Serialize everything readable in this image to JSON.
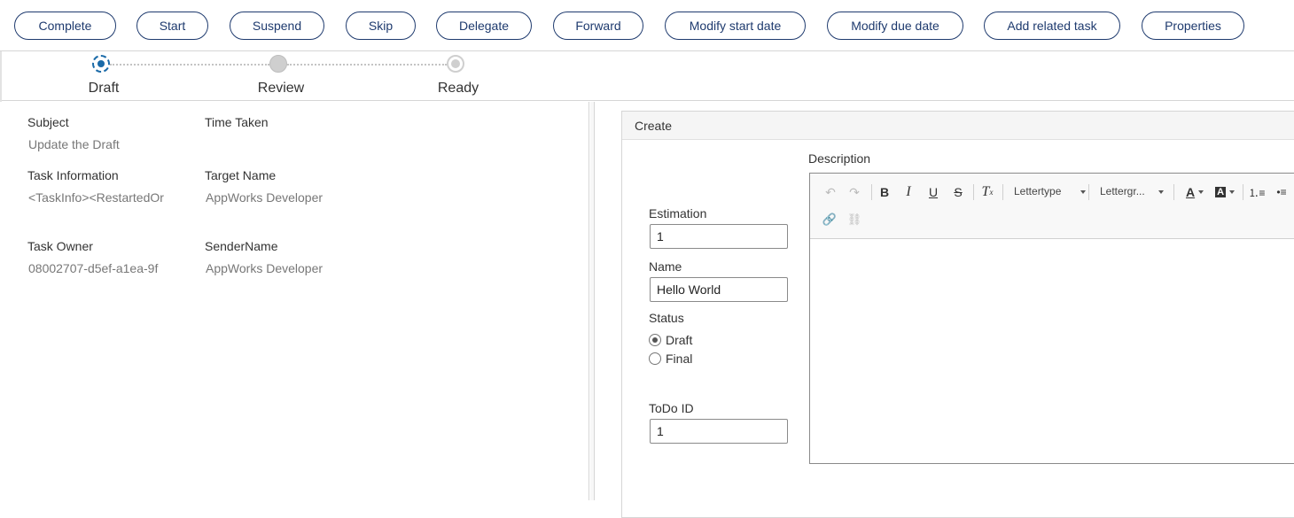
{
  "toolbar": {
    "complete": "Complete",
    "start": "Start",
    "suspend": "Suspend",
    "skip": "Skip",
    "delegate": "Delegate",
    "forward": "Forward",
    "modify_start": "Modify start date",
    "modify_due": "Modify due date",
    "add_related": "Add related task",
    "properties": "Properties"
  },
  "stepper": {
    "steps": [
      "Draft",
      "Review",
      "Ready"
    ],
    "current_step": "Draft"
  },
  "task_info": {
    "subject_label": "Subject",
    "subject_value": "Update the Draft",
    "time_taken_label": "Time Taken",
    "task_information_label": "Task Information",
    "task_information_value": "<TaskInfo><RestartedOr",
    "target_name_label": "Target Name",
    "target_name_value": "AppWorks Developer",
    "task_owner_label": "Task Owner",
    "task_owner_value": "08002707-d5ef-a1ea-9f",
    "sender_name_label": "SenderName",
    "sender_name_value": "AppWorks Developer"
  },
  "form": {
    "title": "Create",
    "estimation_label": "Estimation",
    "estimation_value": "1",
    "name_label": "Name",
    "name_value": "Hello World",
    "status_label": "Status",
    "status_options": [
      "Draft",
      "Final"
    ],
    "status_selected": "Draft",
    "todo_id_label": "ToDo ID",
    "todo_id_value": "1",
    "description_label": "Description"
  },
  "editor": {
    "font_family": "Lettertype",
    "font_size": "Lettergr...",
    "icons": [
      "undo-icon",
      "redo-icon",
      "bold-icon",
      "italic-icon",
      "underline-icon",
      "strikethrough-icon",
      "remove-format-icon",
      "font-color-icon",
      "background-color-icon",
      "numbered-list-icon",
      "bulleted-list-icon",
      "link-icon",
      "unlink-icon"
    ]
  },
  "colors": {
    "button_border": "#1e3a6e",
    "step_active": "#1a6aa8",
    "step_inactive": "#cfcfcf"
  }
}
